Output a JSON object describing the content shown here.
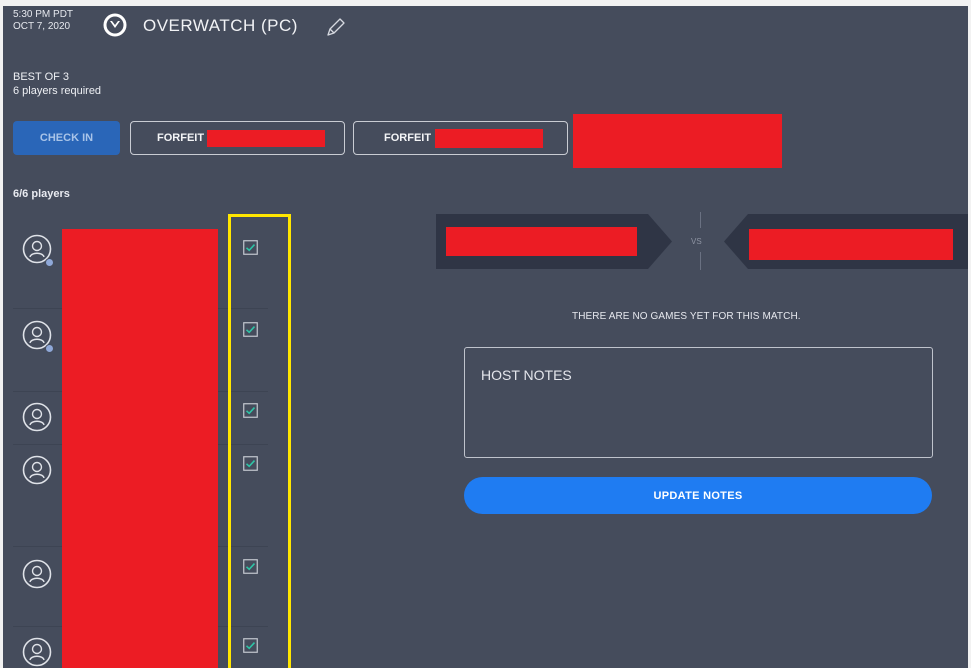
{
  "header": {
    "time": "5:30 PM PDT",
    "date": "OCT 7, 2020",
    "game_title": "OVERWATCH (PC)",
    "logo_icon": "overwatch-logo-icon",
    "edit_icon": "pencil-icon"
  },
  "format": {
    "best_of": "BEST OF 3",
    "players_required": "6 players required"
  },
  "actions": {
    "check_in_label": "CHECK IN",
    "forfeit_label_1": "FORFEIT",
    "forfeit_label_2": "FORFEIT"
  },
  "roster": {
    "count_label": "6/6 players",
    "players": [
      {
        "name": "",
        "checked": true
      },
      {
        "name": "",
        "checked": true
      },
      {
        "name": "",
        "checked": true
      },
      {
        "name": "",
        "checked": true
      },
      {
        "name": "",
        "checked": true
      },
      {
        "name": "",
        "checked": true
      }
    ]
  },
  "match": {
    "vs_label": "VS",
    "no_games_text": "THERE ARE NO GAMES YET FOR THIS MATCH."
  },
  "notes": {
    "placeholder": "HOST NOTES",
    "update_label": "UPDATE NOTES"
  },
  "colors": {
    "background": "#454c5c",
    "check_in_button": "#2a66b8",
    "update_button": "#1f7cf2",
    "checkbox_accent": "#2ec4a6",
    "redaction": "#ec1c24",
    "highlight": "#ffe600"
  }
}
